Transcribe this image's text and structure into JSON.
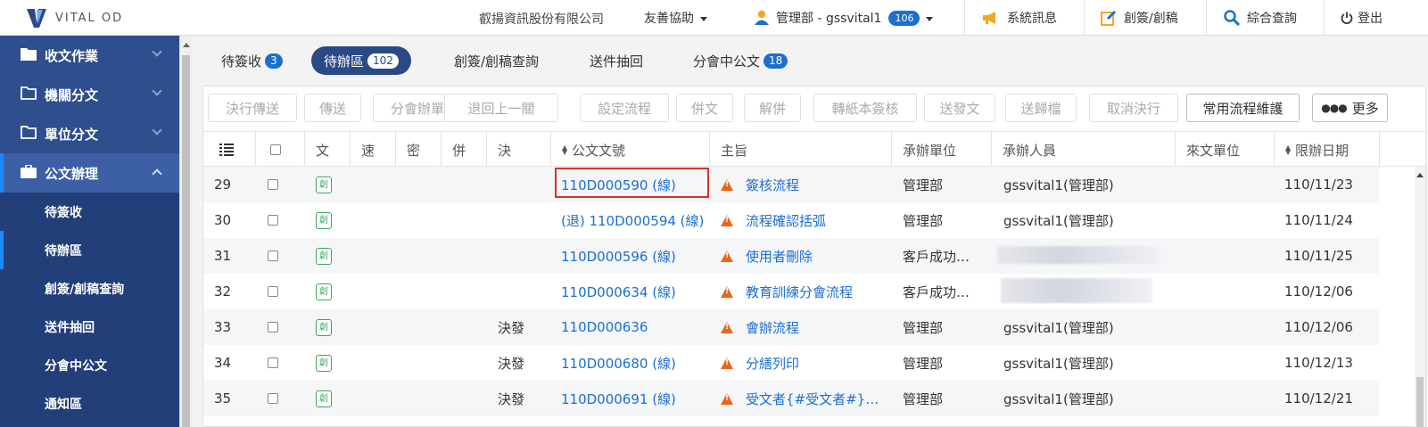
{
  "header": {
    "logo_text": "VITAL OD",
    "company": "叡揚資訊股份有限公司",
    "friendly_assist": "友善協助",
    "user": "管理部 - gssvital1",
    "user_count": "106",
    "system_msg": "系統訊息",
    "create_sign": "創簽/創稿",
    "search": "綜合查詢",
    "logout": "登出"
  },
  "sidebar": {
    "main": [
      {
        "label": "收文作業"
      },
      {
        "label": "機關分文"
      },
      {
        "label": "單位分文"
      },
      {
        "label": "公文辦理"
      }
    ],
    "sub": [
      {
        "label": "待簽收"
      },
      {
        "label": "待辦區"
      },
      {
        "label": "創簽/創稿查詢"
      },
      {
        "label": "送件抽回"
      },
      {
        "label": "分會中公文"
      },
      {
        "label": "通知區"
      }
    ]
  },
  "tabs": [
    {
      "label": "待簽收",
      "count": "3"
    },
    {
      "label": "待辦區",
      "count": "102"
    },
    {
      "label": "創簽/創稿查詢",
      "count": ""
    },
    {
      "label": "送件抽回",
      "count": ""
    },
    {
      "label": "分會中公文",
      "count": "18"
    }
  ],
  "toolbar": {
    "buttons": [
      "決行傳送",
      "傳送",
      "分會辦單",
      "退回上一關",
      "設定流程",
      "併文",
      "解併",
      "轉紙本簽核",
      "送發文",
      "送歸檔",
      "取消決行",
      "常用流程維護"
    ],
    "more": "更多"
  },
  "table": {
    "columns": [
      "文",
      "速",
      "密",
      "併",
      "決",
      "公文文號",
      "主旨",
      "承辦單位",
      "承辦人員",
      "來文單位",
      "限辦日期"
    ],
    "rows": [
      {
        "no": "29",
        "tag": "創",
        "decision": "",
        "doc": "110D000590 (線)",
        "subject": "簽核流程",
        "unit": "管理部",
        "person": "gssvital1(管理部)",
        "due": "110/11/23"
      },
      {
        "no": "30",
        "tag": "創",
        "decision": "",
        "doc": "(退) 110D000594 (線)",
        "subject": "流程確認括弧",
        "unit": "管理部",
        "person": "gssvital1(管理部)",
        "due": "110/11/24"
      },
      {
        "no": "31",
        "tag": "創",
        "decision": "",
        "doc": "110D000596 (線)",
        "subject": "使用者刪除",
        "unit": "客戶成功…",
        "person": "",
        "due": "110/11/25"
      },
      {
        "no": "32",
        "tag": "創",
        "decision": "",
        "doc": "110D000634 (線)",
        "subject": "教育訓練分會流程",
        "unit": "客戶成功…",
        "person": "",
        "due": "110/12/06"
      },
      {
        "no": "33",
        "tag": "創",
        "decision": "決發",
        "doc": "110D000636",
        "subject": "會辦流程",
        "unit": "管理部",
        "person": "gssvital1(管理部)",
        "due": "110/12/06"
      },
      {
        "no": "34",
        "tag": "創",
        "decision": "決發",
        "doc": "110D000680 (線)",
        "subject": "分繕列印",
        "unit": "管理部",
        "person": "gssvital1(管理部)",
        "due": "110/12/13"
      },
      {
        "no": "35",
        "tag": "創",
        "decision": "決發",
        "doc": "110D000691 (線)",
        "subject": "受文者{#受文者#}…",
        "unit": "管理部",
        "person": "gssvital1(管理部)",
        "due": "110/12/21"
      }
    ]
  }
}
